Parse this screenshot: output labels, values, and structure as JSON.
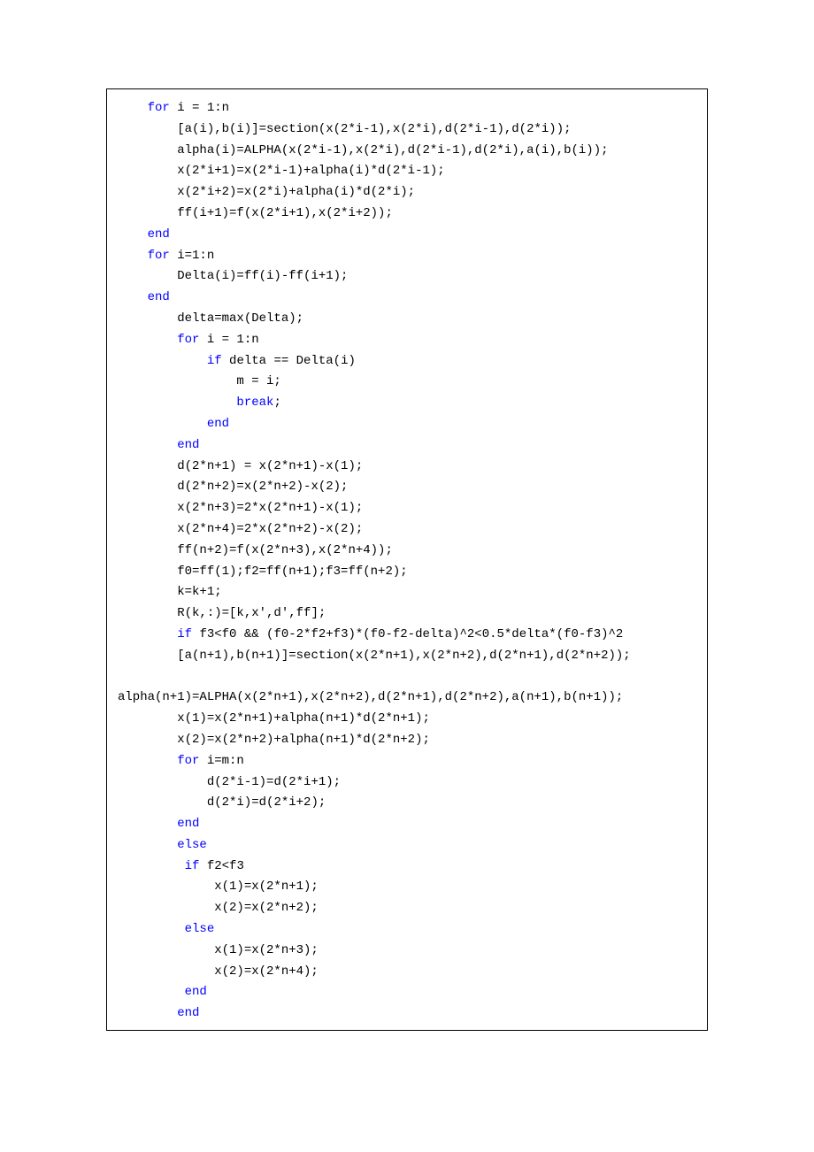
{
  "code_lines": [
    {
      "indent": 4,
      "tokens": [
        {
          "t": "for ",
          "c": "kw"
        },
        {
          "t": "i = 1:n"
        }
      ]
    },
    {
      "indent": 8,
      "tokens": [
        {
          "t": "[a(i),b(i)]=section(x(2*i-1),x(2*i),d(2*i-1),d(2*i));"
        }
      ]
    },
    {
      "indent": 8,
      "tokens": [
        {
          "t": "alpha(i)=ALPHA(x(2*i-1),x(2*i),d(2*i-1),d(2*i),a(i),b(i));"
        }
      ]
    },
    {
      "indent": 8,
      "tokens": [
        {
          "t": "x(2*i+1)=x(2*i-1)+alpha(i)*d(2*i-1);"
        }
      ]
    },
    {
      "indent": 8,
      "tokens": [
        {
          "t": "x(2*i+2)=x(2*i)+alpha(i)*d(2*i);"
        }
      ]
    },
    {
      "indent": 8,
      "tokens": [
        {
          "t": "ff(i+1)=f(x(2*i+1),x(2*i+2));"
        }
      ]
    },
    {
      "indent": 4,
      "tokens": [
        {
          "t": "end",
          "c": "kw"
        }
      ]
    },
    {
      "indent": 4,
      "tokens": [
        {
          "t": "for ",
          "c": "kw"
        },
        {
          "t": "i=1:n"
        }
      ]
    },
    {
      "indent": 8,
      "tokens": [
        {
          "t": "Delta(i)=ff(i)-ff(i+1);"
        }
      ]
    },
    {
      "indent": 4,
      "tokens": [
        {
          "t": "end",
          "c": "kw"
        }
      ]
    },
    {
      "indent": 8,
      "tokens": [
        {
          "t": "delta=max(Delta);"
        }
      ]
    },
    {
      "indent": 8,
      "tokens": [
        {
          "t": "for ",
          "c": "kw"
        },
        {
          "t": "i = 1:n"
        }
      ]
    },
    {
      "indent": 12,
      "tokens": [
        {
          "t": "if ",
          "c": "kw"
        },
        {
          "t": "delta == Delta(i)"
        }
      ]
    },
    {
      "indent": 16,
      "tokens": [
        {
          "t": "m = i;"
        }
      ]
    },
    {
      "indent": 16,
      "tokens": [
        {
          "t": "break",
          "c": "kw"
        },
        {
          "t": ";"
        }
      ]
    },
    {
      "indent": 12,
      "tokens": [
        {
          "t": "end",
          "c": "kw"
        }
      ]
    },
    {
      "indent": 8,
      "tokens": [
        {
          "t": "end",
          "c": "kw"
        }
      ]
    },
    {
      "indent": 8,
      "tokens": [
        {
          "t": "d(2*n+1) = x(2*n+1)-x(1);"
        }
      ]
    },
    {
      "indent": 8,
      "tokens": [
        {
          "t": "d(2*n+2)=x(2*n+2)-x(2);"
        }
      ]
    },
    {
      "indent": 8,
      "tokens": [
        {
          "t": "x(2*n+3)=2*x(2*n+1)-x(1);"
        }
      ]
    },
    {
      "indent": 8,
      "tokens": [
        {
          "t": "x(2*n+4)=2*x(2*n+2)-x(2);"
        }
      ]
    },
    {
      "indent": 8,
      "tokens": [
        {
          "t": "ff(n+2)=f(x(2*n+3),x(2*n+4));"
        }
      ]
    },
    {
      "indent": 8,
      "tokens": [
        {
          "t": "f0=ff(1);f2=ff(n+1);f3=ff(n+2);"
        }
      ]
    },
    {
      "indent": 8,
      "tokens": [
        {
          "t": "k=k+1;"
        }
      ]
    },
    {
      "indent": 8,
      "tokens": [
        {
          "t": "R(k,:)=[k,x',d',ff];"
        }
      ]
    },
    {
      "indent": 8,
      "tokens": [
        {
          "t": "if ",
          "c": "kw"
        },
        {
          "t": "f3<f0 && (f0-2*f2+f3)*(f0-f2-delta)^2<0.5*delta*(f0-f3)^2"
        }
      ]
    },
    {
      "indent": 8,
      "tokens": [
        {
          "t": "[a(n+1),b(n+1)]=section(x(2*n+1),x(2*n+2),d(2*n+1),d(2*n+2));"
        }
      ]
    },
    {
      "indent": 0,
      "tokens": [
        {
          "t": ""
        }
      ]
    },
    {
      "indent": 0,
      "tokens": [
        {
          "t": "alpha(n+1)=ALPHA(x(2*n+1),x(2*n+2),d(2*n+1),d(2*n+2),a(n+1),b(n+1));"
        }
      ]
    },
    {
      "indent": 8,
      "tokens": [
        {
          "t": "x(1)=x(2*n+1)+alpha(n+1)*d(2*n+1);"
        }
      ]
    },
    {
      "indent": 8,
      "tokens": [
        {
          "t": "x(2)=x(2*n+2)+alpha(n+1)*d(2*n+2);"
        }
      ]
    },
    {
      "indent": 8,
      "tokens": [
        {
          "t": "for ",
          "c": "kw"
        },
        {
          "t": "i=m:n"
        }
      ]
    },
    {
      "indent": 12,
      "tokens": [
        {
          "t": "d(2*i-1)=d(2*i+1);"
        }
      ]
    },
    {
      "indent": 12,
      "tokens": [
        {
          "t": "d(2*i)=d(2*i+2);"
        }
      ]
    },
    {
      "indent": 8,
      "tokens": [
        {
          "t": "end",
          "c": "kw"
        }
      ]
    },
    {
      "indent": 8,
      "tokens": [
        {
          "t": "else",
          "c": "kw"
        }
      ]
    },
    {
      "indent": 9,
      "tokens": [
        {
          "t": "if ",
          "c": "kw"
        },
        {
          "t": "f2<f3"
        }
      ]
    },
    {
      "indent": 13,
      "tokens": [
        {
          "t": "x(1)=x(2*n+1);"
        }
      ]
    },
    {
      "indent": 13,
      "tokens": [
        {
          "t": "x(2)=x(2*n+2);"
        }
      ]
    },
    {
      "indent": 9,
      "tokens": [
        {
          "t": "else",
          "c": "kw"
        }
      ]
    },
    {
      "indent": 13,
      "tokens": [
        {
          "t": "x(1)=x(2*n+3);"
        }
      ]
    },
    {
      "indent": 13,
      "tokens": [
        {
          "t": "x(2)=x(2*n+4);"
        }
      ]
    },
    {
      "indent": 9,
      "tokens": [
        {
          "t": "end",
          "c": "kw"
        }
      ]
    },
    {
      "indent": 8,
      "tokens": [
        {
          "t": "end",
          "c": "kw"
        }
      ]
    }
  ]
}
